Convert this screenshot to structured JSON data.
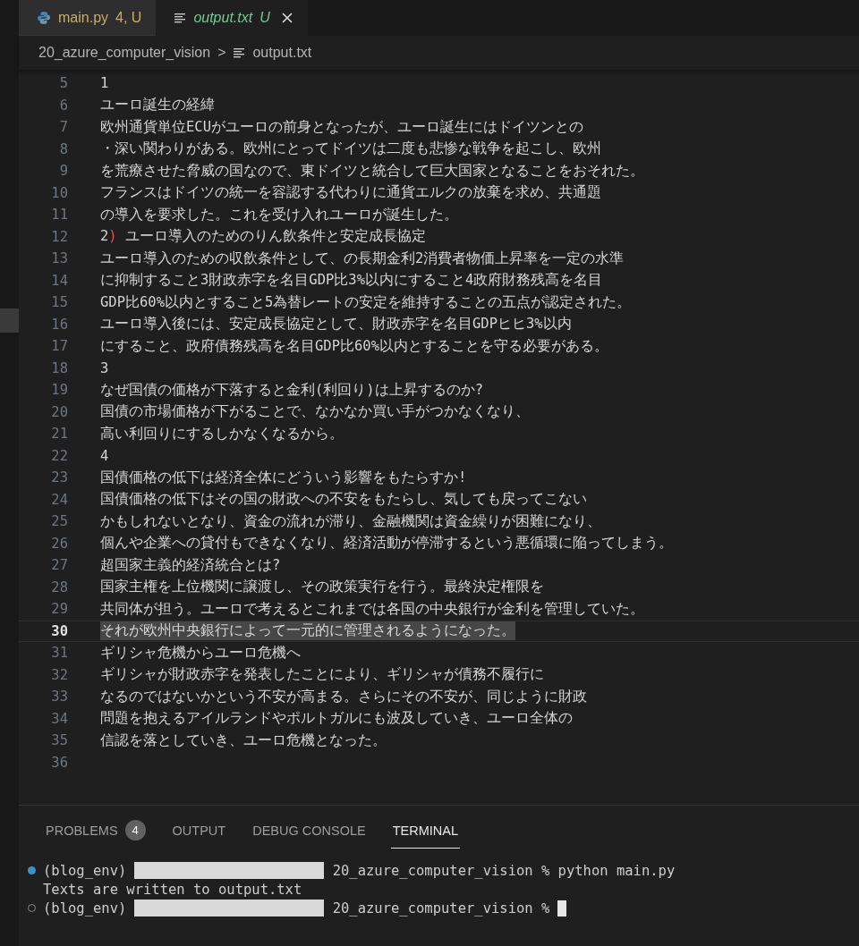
{
  "tabs": [
    {
      "kind": "python",
      "label": "main.py",
      "status": "4, U",
      "selected": false,
      "closable": false
    },
    {
      "kind": "text",
      "label": "output.txt",
      "status": "U",
      "selected": true,
      "closable": true
    }
  ],
  "breadcrumb": {
    "folder": "20_azure_computer_vision",
    "separator": ">",
    "file": "output.txt"
  },
  "editor": {
    "lines": [
      {
        "number": "5",
        "current": false,
        "segments": [
          {
            "text": "1"
          }
        ]
      },
      {
        "number": "6",
        "current": false,
        "segments": [
          {
            "text": "ユーロ誕生の経緯"
          }
        ]
      },
      {
        "number": "7",
        "current": false,
        "segments": [
          {
            "text": "欧州通貨単位ECUがユーロの前身となったが、ユーロ誕生にはドイツンとの"
          }
        ]
      },
      {
        "number": "8",
        "current": false,
        "segments": [
          {
            "text": "・深い関わりがある。欧州にとってドイツは二度も悲惨な戦争を起こし、欧州"
          }
        ]
      },
      {
        "number": "9",
        "current": false,
        "segments": [
          {
            "text": "を荒療させた脅威の国なので、東ドイツと統合して巨大国家となることをおそれた。"
          }
        ]
      },
      {
        "number": "10",
        "current": false,
        "segments": [
          {
            "text": "フランスはドイツの統一を容認する代わりに通貨エルクの放棄を求め、共通題"
          }
        ]
      },
      {
        "number": "11",
        "current": false,
        "segments": [
          {
            "text": "の導入を要求した。これを受け入れユーロが誕生した。"
          }
        ]
      },
      {
        "number": "12",
        "current": false,
        "segments": [
          {
            "text": "2"
          },
          {
            "text": ")",
            "kind": "unmatched"
          },
          {
            "text": " ユーロ導入のためのりん飲条件と安定成長協定"
          }
        ]
      },
      {
        "number": "13",
        "current": false,
        "segments": [
          {
            "text": "ユーロ導入のための収飲条件として、の長期金利2消費者物価上昇率を一定の水準"
          }
        ]
      },
      {
        "number": "14",
        "current": false,
        "segments": [
          {
            "text": "に抑制すること3財政赤字を名目GDP比3%以内にすること4政府財務残高を名目"
          }
        ]
      },
      {
        "number": "15",
        "current": false,
        "segments": [
          {
            "text": "GDP比60%以内とすること5為替レートの安定を維持することの五点が認定された。"
          }
        ]
      },
      {
        "number": "16",
        "current": false,
        "segments": [
          {
            "text": "ユーロ導入後には、安定成長協定として、財政赤字を名目GDPヒヒ3%以内"
          }
        ]
      },
      {
        "number": "17",
        "current": false,
        "segments": [
          {
            "text": "にすること、政府債務残高を名目GDP比60%以内とすることを守る必要がある。"
          }
        ]
      },
      {
        "number": "18",
        "current": false,
        "segments": [
          {
            "text": "3"
          }
        ]
      },
      {
        "number": "19",
        "current": false,
        "segments": [
          {
            "text": "なぜ国債の価格が下落すると金利(利回り)は上昇するのか?"
          }
        ]
      },
      {
        "number": "20",
        "current": false,
        "segments": [
          {
            "text": "国債の市場価格が下がることで、なかなか買い手がつかなくなり、"
          }
        ]
      },
      {
        "number": "21",
        "current": false,
        "segments": [
          {
            "text": "高い利回りにするしかなくなるから。"
          }
        ]
      },
      {
        "number": "22",
        "current": false,
        "segments": [
          {
            "text": "4"
          }
        ]
      },
      {
        "number": "23",
        "current": false,
        "segments": [
          {
            "text": "国債価格の低下は経済全体にどういう影響をもたらすか!"
          }
        ]
      },
      {
        "number": "24",
        "current": false,
        "segments": [
          {
            "text": "国債価格の低下はその国の財政への不安をもたらし、気しても戻ってこない"
          }
        ]
      },
      {
        "number": "25",
        "current": false,
        "segments": [
          {
            "text": "かもしれないとなり、資金の流れが滞り、金融機関は資金繰りが困難になり、"
          }
        ]
      },
      {
        "number": "26",
        "current": false,
        "segments": [
          {
            "text": "個んや企業への貸付もできなくなり、経済活動が停滞するという悪循環に陥ってしまう。"
          }
        ]
      },
      {
        "number": "27",
        "current": false,
        "segments": [
          {
            "text": "超国家主義的経済統合とは?"
          }
        ]
      },
      {
        "number": "28",
        "current": false,
        "segments": [
          {
            "text": "国家主権を上位機関に譲渡し、その政策実行を行う。最終決定権限を"
          }
        ]
      },
      {
        "number": "29",
        "current": false,
        "segments": [
          {
            "text": "共同体が担う。ユーロで考えるとこれまでは各国の中央銀行が金利を管理していた。"
          }
        ]
      },
      {
        "number": "30",
        "current": true,
        "segments": [
          {
            "text": "それが欧州中央銀行によって一元的に管理されるようになった。"
          }
        ]
      },
      {
        "number": "31",
        "current": false,
        "segments": [
          {
            "text": "ギリシャ危機からユーロ危機へ"
          }
        ]
      },
      {
        "number": "32",
        "current": false,
        "segments": [
          {
            "text": "ギリシャが財政赤字を発表したことにより、ギリシャが債務不履行に"
          }
        ]
      },
      {
        "number": "33",
        "current": false,
        "segments": [
          {
            "text": "なるのではないかという不安が高まる。さらにその不安が、同じように財政"
          }
        ]
      },
      {
        "number": "34",
        "current": false,
        "segments": [
          {
            "text": "問題を抱えるアイルランドやポルトガルにも波及していき、ユーロ全体の"
          }
        ]
      },
      {
        "number": "35",
        "current": false,
        "segments": [
          {
            "text": "信認を落としていき、ユーロ危機となった。"
          }
        ]
      },
      {
        "number": "36",
        "current": false
      }
    ]
  },
  "panel": {
    "tabs": [
      {
        "label": "PROBLEMS",
        "badge": "4",
        "selected": false
      },
      {
        "label": "OUTPUT",
        "selected": false
      },
      {
        "label": "DEBUG CONSOLE",
        "selected": false
      },
      {
        "label": "TERMINAL",
        "selected": true
      }
    ],
    "terminal": [
      {
        "kind": "prompt",
        "succeeded": true,
        "env": "(blog_env)",
        "redacted": true,
        "text": " 20_azure_computer_vision % python main.py",
        "cursor": false
      },
      {
        "kind": "output",
        "text": "Texts are written to output.txt"
      },
      {
        "kind": "prompt",
        "succeeded": false,
        "env": "(blog_env)",
        "redacted": true,
        "text": " 20_azure_computer_vision %",
        "cursor": true
      }
    ]
  }
}
